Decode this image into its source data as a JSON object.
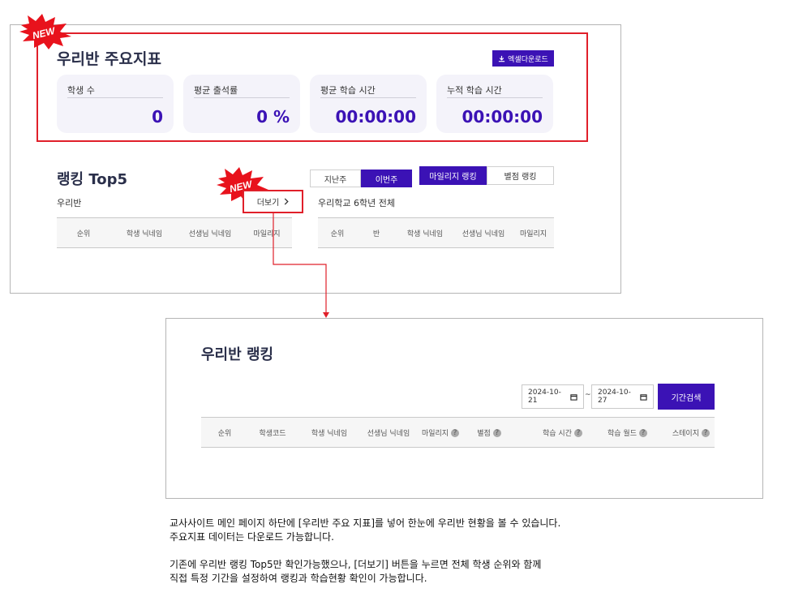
{
  "badges": {
    "new": "NEW"
  },
  "top_panel": {
    "title": "우리반 주요지표",
    "excel_button": "엑셀다운로드",
    "stats": [
      {
        "label": "학생 수",
        "value": "0"
      },
      {
        "label": "평균 출석률",
        "value": "0 %"
      },
      {
        "label": "평균 학습 시간",
        "value": "00:00:00"
      },
      {
        "label": "누적 학습 시간",
        "value": "00:00:00"
      }
    ]
  },
  "ranking": {
    "title": "랭킹 Top5",
    "period_tabs": [
      "지난주",
      "이번주"
    ],
    "type_tabs": [
      "마일리지 랭킹",
      "별점 랭킹"
    ],
    "left": {
      "subtitle": "우리반",
      "more": "더보기",
      "columns": [
        "순위",
        "학생 닉네임",
        "선생님 닉네임",
        "마일리지"
      ]
    },
    "right": {
      "subtitle": "우리학교 6학년 전체",
      "columns": [
        "순위",
        "반",
        "학생 닉네임",
        "선생님 닉네임",
        "마일리지"
      ]
    }
  },
  "class_ranking": {
    "title": "우리반 랭킹",
    "date_from": "2024-10-21",
    "date_to": "2024-10-27",
    "date_separator": "~",
    "search_button": "기간검색",
    "columns": [
      "순위",
      "학생코드",
      "학생 닉네임",
      "선생님 닉네임",
      "마일리지",
      "별점",
      "학습 시간",
      "학습 월드",
      "스테이지"
    ]
  },
  "description": {
    "line1": "교사사이트 메인 페이지 하단에 [우리반 주요 지표]를 넣어 한눈에 우리반 현황을 볼 수 있습니다.",
    "line2": "주요지표 데이터는 다운로드 가능합니다.",
    "line3": "기존에 우리반 랭킹 Top5만 확인가능했으나, [더보기] 버튼을 누르면 전체 학생 순위와 함께",
    "line4": "직접 특정 기간을 설정하여 랭킹과 학습현황 확인이 가능합니다."
  },
  "colors": {
    "accent": "#3b12b5",
    "highlight": "#e0202a",
    "card_bg": "#f4f3fa"
  }
}
